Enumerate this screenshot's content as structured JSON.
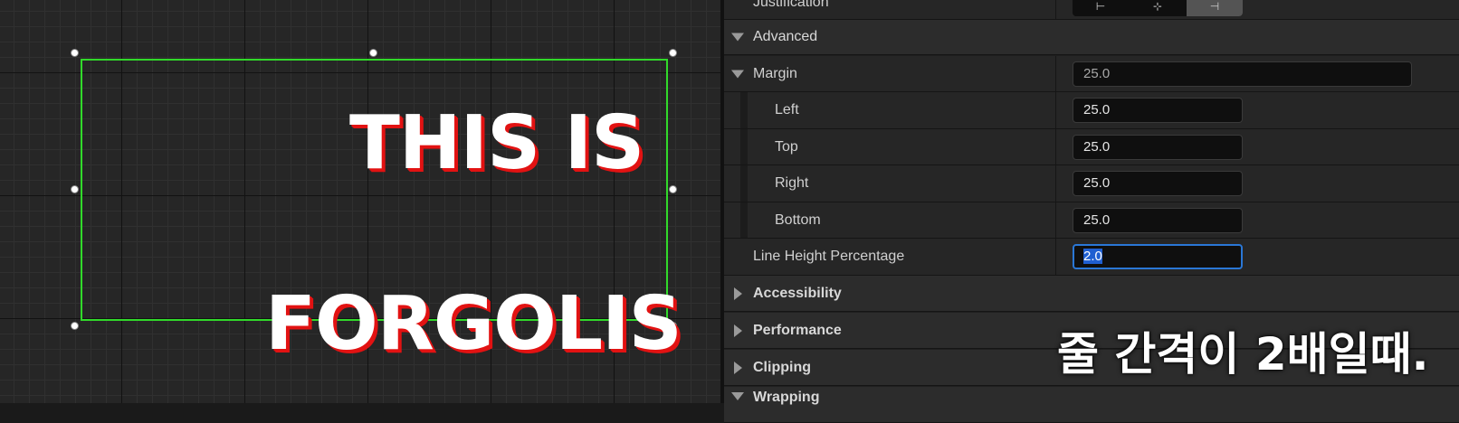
{
  "viewport": {
    "text_line_1": "THIS IS",
    "text_line_2": "FORGOLIS"
  },
  "details": {
    "justification": {
      "label": "Justification",
      "options": [
        "left-align-icon",
        "center-align-icon",
        "right-align-icon"
      ],
      "option_glyphs": [
        "⊢",
        "⊹",
        "⊣"
      ],
      "selected": "right"
    },
    "advanced": {
      "label": "Advanced"
    },
    "margin": {
      "label": "Margin",
      "value": "25.0"
    },
    "left": {
      "label": "Left",
      "value": "25.0"
    },
    "top": {
      "label": "Top",
      "value": "25.0"
    },
    "right": {
      "label": "Right",
      "value": "25.0"
    },
    "bottom": {
      "label": "Bottom",
      "value": "25.0"
    },
    "line_height": {
      "label": "Line Height Percentage",
      "value": "2.0"
    },
    "categories": {
      "accessibility": "Accessibility",
      "performance": "Performance",
      "clipping": "Clipping",
      "wrapping": "Wrapping"
    }
  },
  "caption": "줄 간격이 2배일때.",
  "colors": {
    "selection_outline": "#31d92a",
    "text_shadow": "#e21212",
    "focus_outline": "#2a77d6"
  }
}
